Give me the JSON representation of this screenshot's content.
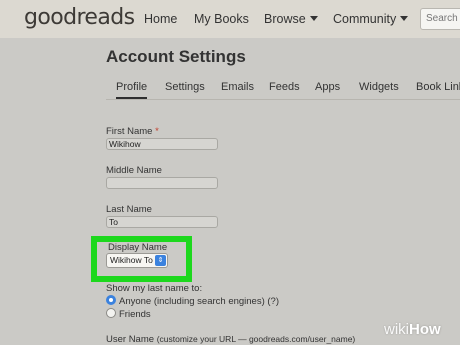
{
  "header": {
    "logo": "goodreads",
    "nav": [
      {
        "label": "Home"
      },
      {
        "label": "My Books"
      },
      {
        "label": "Browse"
      },
      {
        "label": "Community"
      }
    ],
    "search_placeholder": "Search books"
  },
  "page": {
    "title": "Account Settings",
    "tabs": [
      {
        "label": "Profile",
        "active": true
      },
      {
        "label": "Settings"
      },
      {
        "label": "Emails"
      },
      {
        "label": "Feeds"
      },
      {
        "label": "Apps"
      },
      {
        "label": "Widgets"
      },
      {
        "label": "Book Links"
      }
    ]
  },
  "form": {
    "first_name": {
      "label": "First Name",
      "required_mark": "*",
      "value": "Wikihow"
    },
    "middle_name": {
      "label": "Middle Name",
      "value": ""
    },
    "last_name": {
      "label": "Last Name",
      "value": "To"
    },
    "display_name": {
      "label": "Display Name",
      "selected": "Wikihow To",
      "arrows": "⇕"
    },
    "show_last_name": {
      "label": "Show my last name to:",
      "options": [
        {
          "label": "Anyone (including search engines) (?)",
          "checked": true
        },
        {
          "label": "Friends",
          "checked": false
        }
      ]
    },
    "user_name": {
      "label": "User Name",
      "hint": "(customize your URL — goodreads.com/user_name)"
    }
  },
  "highlight_color": "#1dd81d",
  "accent_color": "#3b82de",
  "watermark": {
    "prefix": "wiki",
    "suffix": "How"
  }
}
